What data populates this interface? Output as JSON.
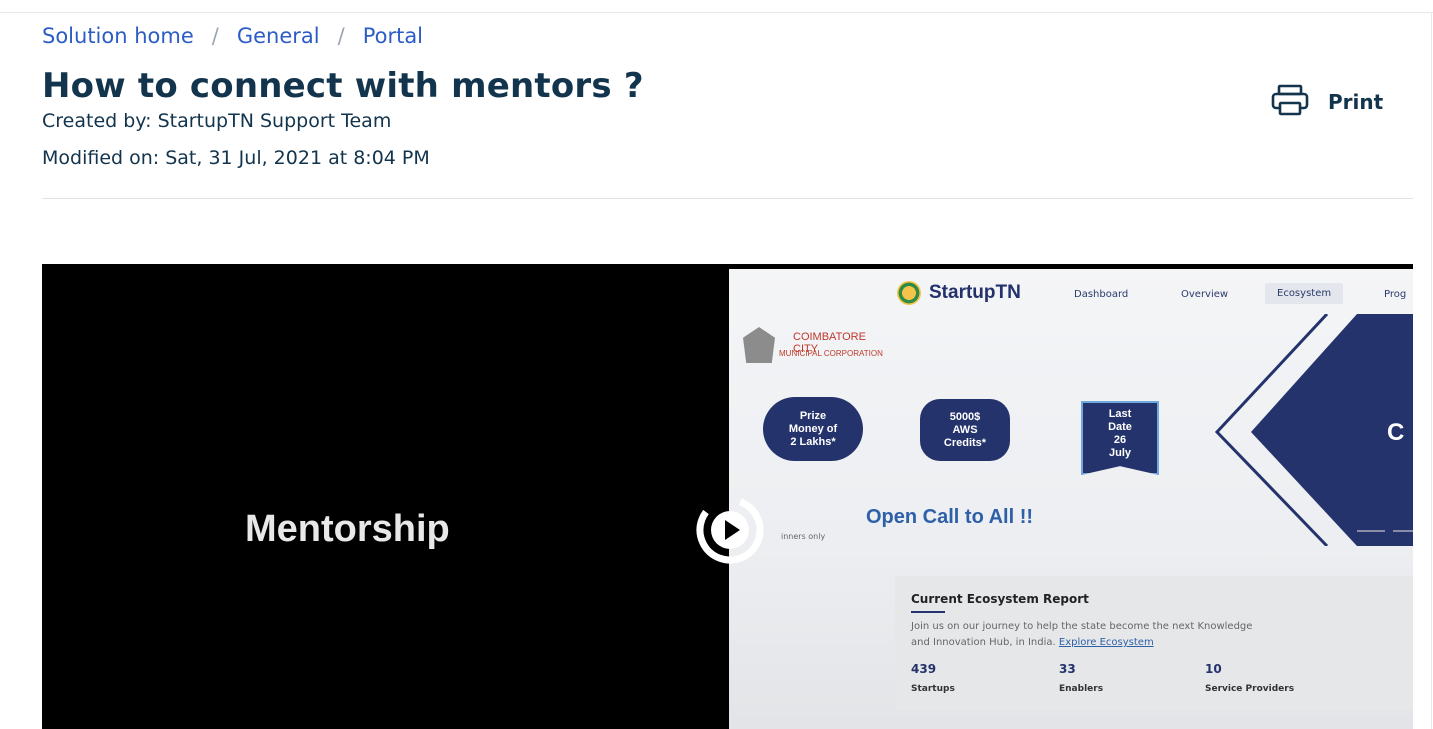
{
  "breadcrumb": {
    "items": [
      "Solution home",
      "General",
      "Portal"
    ],
    "separator": "/"
  },
  "article": {
    "title": "How to connect with mentors ?",
    "created_by": "Created by: StartupTN Support Team",
    "modified_on": "Modified on: Sat, 31 Jul, 2021 at 8:04 PM"
  },
  "print": {
    "label": "Print",
    "icon": "printer-icon"
  },
  "video": {
    "left_label": "Mentorship",
    "play_icon": "play-icon",
    "screen": {
      "brand": "StartupTN",
      "nav": [
        "Dashboard",
        "Overview",
        "Ecosystem",
        "Prog"
      ],
      "corp_line1": "COIMBATORE CITY",
      "corp_line2": "MUNICIPAL CORPORATION",
      "badge1": [
        "Prize",
        "Money of",
        "2 Lakhs*"
      ],
      "badge2": [
        "5000$",
        "AWS",
        "Credits*"
      ],
      "badge3": [
        "Last",
        "Date",
        "26",
        "July"
      ],
      "open_call": "Open Call to All !!",
      "winners_note": "inners only",
      "report": {
        "title": "Current Ecosystem Report",
        "desc": "Join us on our journey to help the state become the next Knowledge",
        "desc2": "and Innovation Hub, in India.",
        "link": "Explore Ecosystem",
        "stats": [
          {
            "value": "439",
            "label": "Startups"
          },
          {
            "value": "33",
            "label": "Enablers"
          },
          {
            "value": "10",
            "label": "Service Providers"
          }
        ]
      },
      "hero_letter": "C"
    }
  },
  "colors": {
    "link": "#2c5cc5",
    "title": "#12344d",
    "navy": "#24336b"
  }
}
